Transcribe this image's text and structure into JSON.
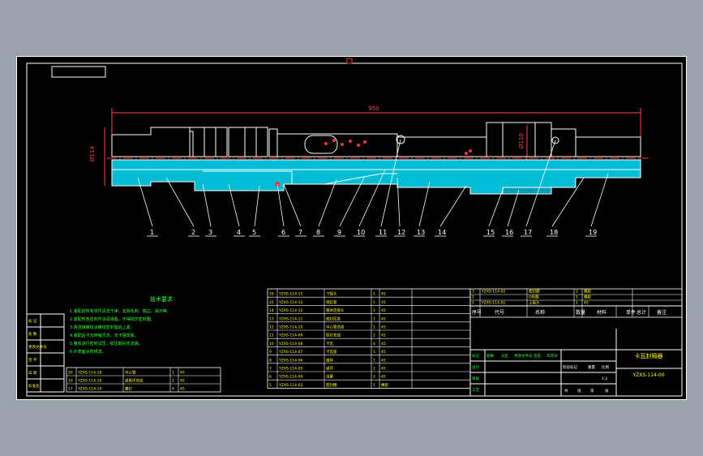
{
  "drawing": {
    "overall_dim": "950",
    "dia_left": "Ø114",
    "dia_right": "Ø110",
    "balloons": [
      "1",
      "2",
      "3",
      "4",
      "5",
      "6",
      "7",
      "8",
      "9",
      "10",
      "11",
      "12",
      "13",
      "14",
      "15",
      "16",
      "17",
      "18",
      "19"
    ]
  },
  "notes": {
    "title": "技术要求",
    "lines": [
      "1.装配前所有零件清洗干净，去除毛刺、锐边、油污等。",
      "2.装配时各密封件涂润滑脂，不得损伤密封圈。",
      "3.各连接螺纹涂螺纹密封脂后上紧。",
      "4.装配后卡瓦伸缩灵活，无卡阻现象。",
      "5.整体进行密封试压，稳压期间无渗漏。",
      "6.外表面涂防锈漆。"
    ]
  },
  "left_block": {
    "labels": [
      "标 记",
      "处 数",
      "更改文件号",
      "签 字",
      "日 期",
      "标准化"
    ]
  },
  "bom_small": [
    {
      "no": "20",
      "code": "YZXS-114-18",
      "name": "中心管",
      "qty": "1",
      "mat": "45"
    },
    {
      "no": "19",
      "code": "YZXS-114-16",
      "name": "锁紧环总成",
      "qty": "1",
      "mat": "45"
    },
    {
      "no": "17",
      "code": "YZXS-114-14",
      "name": "螺钉",
      "qty": "4",
      "mat": "45"
    }
  ],
  "bom_mid": [
    {
      "no": "16",
      "code": "YZXS-114-15",
      "name": "下接头",
      "qty": "1",
      "mat": "45"
    },
    {
      "no": "15",
      "code": "YZXS-114-13",
      "name": "液缸套",
      "qty": "1",
      "mat": "45"
    },
    {
      "no": "14",
      "code": "YZXS-114-12",
      "name": "锥体连接头",
      "qty": "1",
      "mat": "45"
    },
    {
      "no": "13",
      "code": "YZXS-114-11",
      "name": "密封压盖",
      "qty": "1",
      "mat": "45"
    },
    {
      "no": "12",
      "code": "YZXS-114-10",
      "name": "中心管总成",
      "qty": "1",
      "mat": "45"
    },
    {
      "no": "11",
      "code": "YZXS-114-09",
      "name": "剪钉总成",
      "qty": "2",
      "mat": "45"
    },
    {
      "no": "10",
      "code": "YZXS-114-08",
      "name": "卡瓦",
      "qty": "4",
      "mat": "45"
    },
    {
      "no": "9",
      "code": "YZXS-114-07",
      "name": "卡瓦座",
      "qty": "1",
      "mat": "45"
    },
    {
      "no": "8",
      "code": "YZXS-114-06",
      "name": "锥体",
      "qty": "1",
      "mat": "45"
    },
    {
      "no": "7",
      "code": "YZXS-114-05",
      "name": "锁环",
      "qty": "1",
      "mat": "45"
    },
    {
      "no": "6",
      "code": "YZXS-114-04",
      "name": "活塞",
      "qty": "2",
      "mat": "45"
    },
    {
      "no": "5",
      "code": "YZXS-114-03",
      "name": "密封圈",
      "qty": "1",
      "mat": "橡胶"
    }
  ],
  "bom_right": [
    {
      "no": "3",
      "code": "YZXS-114-02",
      "name": "密封圈",
      "qty": "2",
      "mat": "橡胶"
    },
    {
      "no": "2",
      "code": "",
      "name": "O形圈",
      "qty": "1",
      "mat": "橡胶"
    },
    {
      "no": "1",
      "code": "YZXS-114-01",
      "name": "上接头",
      "qty": "1",
      "mat": "45"
    }
  ],
  "bom_header": {
    "no": "序号",
    "code": "代号",
    "name": "名称",
    "qty": "数量",
    "mat": "材料",
    "single": "单件",
    "total": "总计",
    "weight": "重量",
    "remark": "备注"
  },
  "title_block": {
    "title": "卡瓦封隔器",
    "code": "YZXS-114-00",
    "labels": [
      "标记",
      "处数",
      "分区",
      "更改文件号",
      "签名",
      "年月日"
    ],
    "rows": [
      "设计",
      "审核",
      "工艺",
      "批准"
    ],
    "stage_labels": [
      "阶段标记",
      "重量",
      "比例"
    ],
    "scale": "1:2",
    "sheet_labels": [
      "共",
      "张",
      "第",
      "张"
    ]
  },
  "colors": {
    "sheet_bg": "#000000",
    "outline": "#ffffff",
    "section_fill": "#00bcd4",
    "center_line": "#ff3333",
    "dim_line": "#ff4444",
    "notes_text": "#33ff33",
    "label_yellow": "#ffff00",
    "table_lines": "#ffffff"
  }
}
